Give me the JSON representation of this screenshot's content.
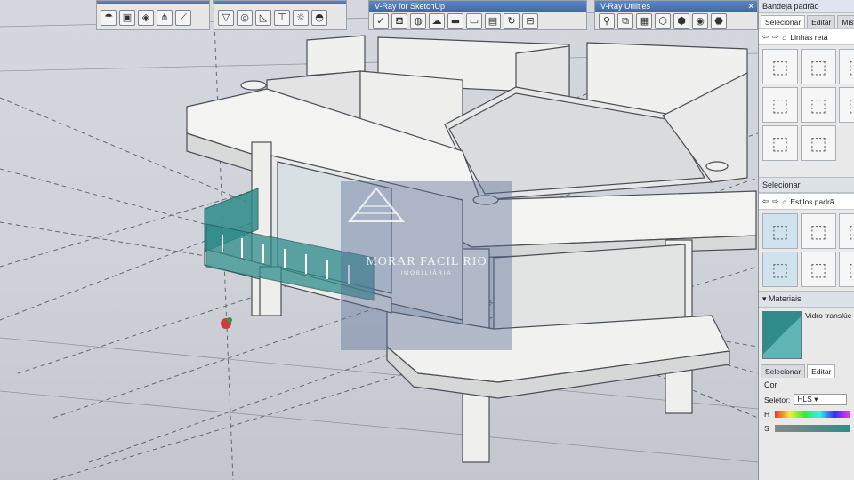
{
  "toolbars": [
    {
      "title": "",
      "icons": [
        "umbrella-icon",
        "cube-icon",
        "cube-alt-icon",
        "grass-icon",
        "stripe-icon"
      ]
    },
    {
      "title": "",
      "icons": [
        "funnel-icon",
        "circle-target-icon",
        "protractor-icon",
        "t-shape-icon",
        "sun-icon",
        "dome-icon"
      ]
    },
    {
      "title": "V-Ray for SketchUp",
      "icons": [
        "vray-check-icon",
        "teapot-icon",
        "globe-icon",
        "cloud-icon",
        "render-icon",
        "monitor-icon",
        "frame-icon",
        "cycle-icon",
        "lock-icon"
      ]
    },
    {
      "title": "V-Ray Utilities",
      "icons": [
        "paint-icon",
        "layers-icon",
        "cube-grid-icon",
        "box-icon",
        "box-b-icon",
        "sphere-icon",
        "hex-icon"
      ]
    }
  ],
  "right_panel": {
    "title": "Bandeja padrão",
    "tabs": [
      "Selecionar",
      "Editar",
      "Mistu"
    ],
    "path_label": "Linhas reta",
    "section_select": "Selecionar",
    "style_label": "Estilos padrã",
    "materials_header": "Materiais",
    "material_name": "Vidro translúc",
    "material_tabs": [
      "Selecionar",
      "Editar"
    ],
    "color_label": "Cor",
    "selector_label": "Seletor:",
    "selector_value": "HLS",
    "channel_h": "H",
    "channel_s": "S"
  },
  "watermark": {
    "name": "MORAR FACIL RIO",
    "sub": "IMOBILIÁRIA"
  },
  "colors": {
    "glass": "#2f8c8a",
    "panel_bg": "#e9e9e9",
    "titlebar": "#4f79b7"
  }
}
